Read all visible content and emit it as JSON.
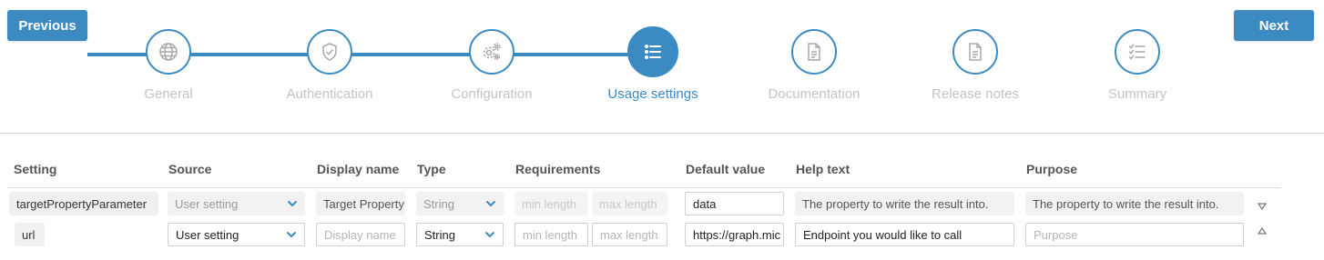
{
  "nav": {
    "previous_label": "Previous",
    "next_label": "Next"
  },
  "steps": [
    {
      "label": "General",
      "icon": "globe-icon"
    },
    {
      "label": "Authentication",
      "icon": "shield-check-icon"
    },
    {
      "label": "Configuration",
      "icon": "gears-icon"
    },
    {
      "label": "Usage settings",
      "icon": "list-icon",
      "active": true
    },
    {
      "label": "Documentation",
      "icon": "document-icon"
    },
    {
      "label": "Release notes",
      "icon": "document-icon"
    },
    {
      "label": "Summary",
      "icon": "checklist-icon"
    }
  ],
  "colors": {
    "accent": "#3b8bc2",
    "inactive_text": "#c4c4c4",
    "active_text": "#3b8bc2"
  },
  "table": {
    "headers": {
      "setting": "Setting",
      "source": "Source",
      "display_name": "Display name",
      "type": "Type",
      "requirements": "Requirements",
      "default_value": "Default value",
      "help_text": "Help text",
      "purpose": "Purpose"
    },
    "rows": [
      {
        "setting": "targetPropertyParameter",
        "source": "User setting",
        "display_name": "Target Property",
        "type": "String",
        "min_length_placeholder": "min length",
        "max_length_placeholder": "max length",
        "default_value": "data",
        "help_text": "The property to write the result into.",
        "purpose": "The property to write the result into."
      },
      {
        "setting": "url",
        "source": "User setting",
        "display_name_placeholder": "Display name",
        "type": "String",
        "min_length_placeholder": "min length",
        "max_length_placeholder": "max length",
        "default_value": "https://graph.mic",
        "help_text": "Endpoint you would like to call",
        "purpose_placeholder": "Purpose"
      }
    ]
  }
}
